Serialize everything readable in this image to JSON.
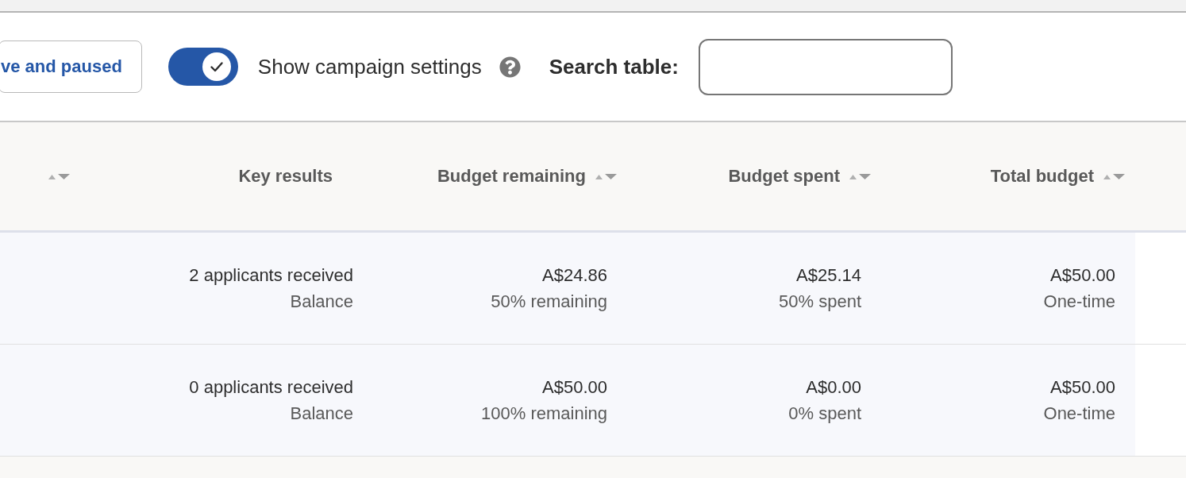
{
  "filter_button": {
    "label": "ve and paused"
  },
  "toggle": {
    "label": "Show campaign settings",
    "on": true
  },
  "search": {
    "label": "Search table:"
  },
  "table": {
    "columns": [
      {
        "sortable": true
      },
      {
        "label": "Key results",
        "sortable": false
      },
      {
        "label": "Budget remaining",
        "sortable": true
      },
      {
        "label": "Budget spent",
        "sortable": true
      },
      {
        "label": "Total budget",
        "sortable": true
      }
    ],
    "rows": [
      {
        "cells": [
          "",
          {
            "value": "2 applicants received",
            "detail": "Balance"
          },
          {
            "value": "A$24.86",
            "detail": "50% remaining"
          },
          {
            "value": "A$25.14",
            "detail": "50% spent"
          },
          {
            "value": "A$50.00",
            "detail": "One-time"
          }
        ]
      },
      {
        "cells": [
          "",
          {
            "value": "0 applicants received",
            "detail": "Balance"
          },
          {
            "value": "A$50.00",
            "detail": "100% remaining"
          },
          {
            "value": "A$0.00",
            "detail": "0% spent"
          },
          {
            "value": "A$50.00",
            "detail": "One-time"
          }
        ]
      }
    ]
  }
}
